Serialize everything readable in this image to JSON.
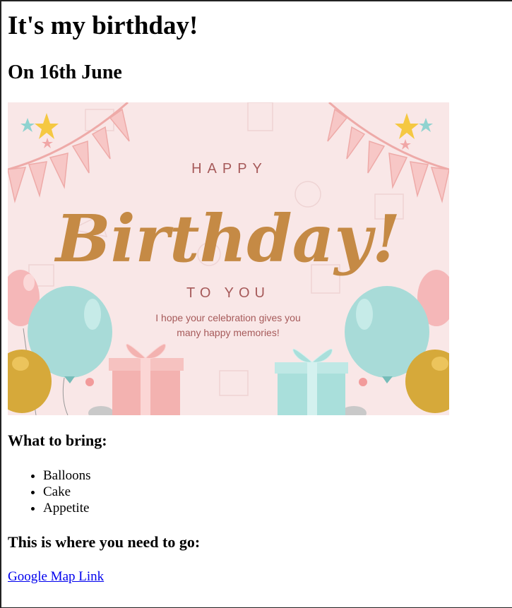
{
  "page": {
    "title": "It's my birthday!",
    "date": "On 16th June"
  },
  "card": {
    "line1": "HAPPY",
    "line2": "Birthday!",
    "line3": "TO YOU",
    "message_line1": "I hope your celebration gives you",
    "message_line2": "many happy memories!",
    "colors": {
      "background": "#f9e6e6",
      "script": "#c58a45",
      "text": "#a65a5a",
      "balloon_teal": "#a8dbd8",
      "balloon_pink": "#f5b7b8",
      "balloon_gold": "#d6a93a",
      "gift_pink": "#f3b2b0",
      "gift_teal": "#a9dfdb"
    }
  },
  "bring": {
    "heading": "What to bring:",
    "items": [
      "Balloons",
      "Cake",
      "Appetite"
    ]
  },
  "location": {
    "heading": "This is where you need to go:",
    "link_text": "Google Map Link"
  }
}
